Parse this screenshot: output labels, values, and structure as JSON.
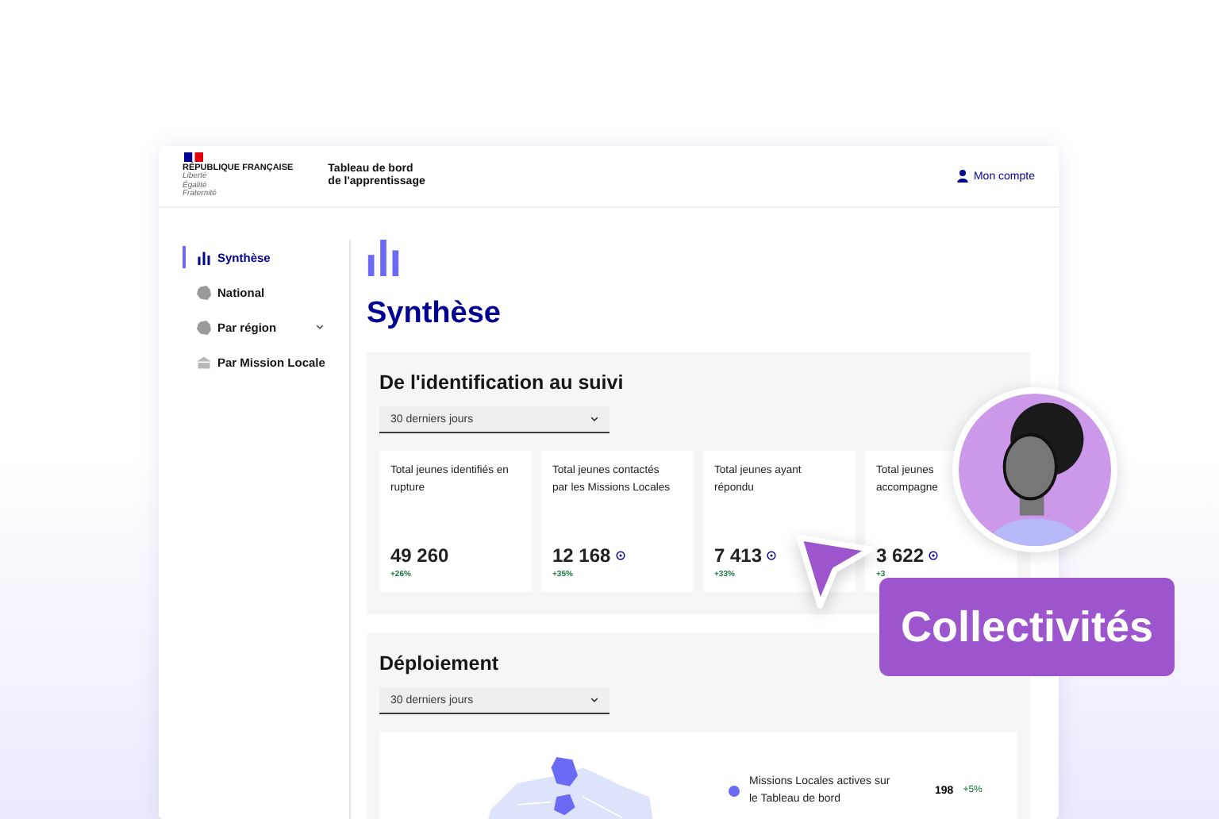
{
  "header": {
    "logo": {
      "name": "RÉPUBLIQUE FRANÇAISE",
      "motto": [
        "Liberté",
        "Égalité",
        "Fraternité"
      ]
    },
    "site_title": [
      "Tableau de bord",
      "de l'apprentissage"
    ],
    "account_link": "Mon compte"
  },
  "sidebar": {
    "items": [
      {
        "label": "Synthèse",
        "kind": "chart",
        "selected": true,
        "has_menu": false
      },
      {
        "label": "National",
        "kind": "map",
        "selected": false,
        "has_menu": false
      },
      {
        "label": "Par région",
        "kind": "map",
        "selected": false,
        "has_menu": true
      },
      {
        "label": "Par Mission Locale",
        "kind": "building",
        "selected": false,
        "has_menu": false
      }
    ]
  },
  "page_title": "Synthèse",
  "sections": [
    {
      "title": "De l'identification au suivi",
      "period": "30 derniers jours",
      "kind": "cards",
      "cards": [
        {
          "title": "Total jeunes identifiés en rupture",
          "value": "49 260",
          "delta": "+26%",
          "info": false
        },
        {
          "title": "Total jeunes contactés par les Missions Locales",
          "value": "12 168",
          "delta": "+35%",
          "info": true
        },
        {
          "title": "Total jeunes ayant répondu",
          "value": "7 413",
          "delta": "+33%",
          "info": true
        },
        {
          "title": "Total jeunes accompagne",
          "value": "3 622",
          "delta": "+3",
          "info": true
        }
      ]
    },
    {
      "title": "Déploiement",
      "period": "30 derniers jours",
      "kind": "map",
      "legend": [
        {
          "label": "Missions Locales actives sur le Tableau de bord",
          "value": "198",
          "delta": "+5%",
          "color": "#6a6af4"
        }
      ]
    }
  ],
  "badge": "Collectivités"
}
